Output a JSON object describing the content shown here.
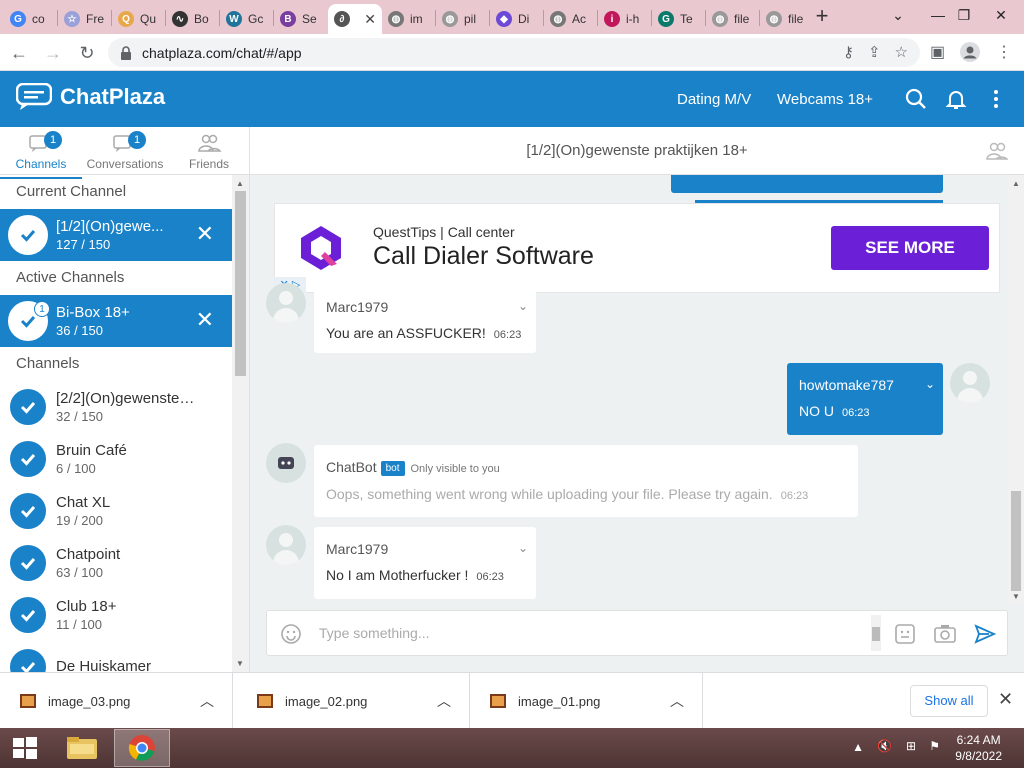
{
  "browser": {
    "tabs": [
      {
        "label": "co",
        "color": "#4285f4",
        "glyph": "G"
      },
      {
        "label": "Fre",
        "color": "#9aa0d8",
        "glyph": "☆"
      },
      {
        "label": "Qu",
        "color": "#e8a84a",
        "glyph": "Q"
      },
      {
        "label": "Bo",
        "color": "#333333",
        "glyph": "∿"
      },
      {
        "label": "Gc",
        "color": "#21759b",
        "glyph": "W"
      },
      {
        "label": "Se",
        "color": "#7a3ea1",
        "glyph": "B"
      },
      {
        "label": "",
        "color": "#555555",
        "glyph": "∂"
      },
      {
        "label": "im",
        "color": "#777777",
        "glyph": "◍"
      },
      {
        "label": "pil",
        "color": "#999999",
        "glyph": "◍"
      },
      {
        "label": "Di",
        "color": "#6d4ad6",
        "glyph": "◆"
      },
      {
        "label": "Ac",
        "color": "#777777",
        "glyph": "◍"
      },
      {
        "label": "i-h",
        "color": "#c2185b",
        "glyph": "i"
      },
      {
        "label": "Te",
        "color": "#0b7a6b",
        "glyph": "G"
      },
      {
        "label": "file",
        "color": "#999999",
        "glyph": "◍"
      },
      {
        "label": "file",
        "color": "#999999",
        "glyph": "◍"
      }
    ],
    "active_tab_index": 6,
    "url": "chatplaza.com/chat/#/app"
  },
  "app": {
    "logo_text": "ChatPlaza",
    "header_links": [
      "Dating M/V",
      "Webcams 18+"
    ],
    "brand_color": "#1a82c9"
  },
  "sidebar": {
    "tabs": [
      {
        "label": "Channels",
        "badge": "1",
        "icon": "chat-bubbles-icon"
      },
      {
        "label": "Conversations",
        "badge": "1",
        "icon": "conversation-icon"
      },
      {
        "label": "Friends",
        "badge": "",
        "icon": "friends-icon"
      }
    ],
    "sections": {
      "current": "Current Channel",
      "active": "Active Channels",
      "channels": "Channels"
    },
    "current_channel": {
      "name": "[1/2](On)gewe...",
      "count": "127 / 150"
    },
    "active_channels": [
      {
        "name": "Bi-Box 18+",
        "count": "36 / 150",
        "badge": "1"
      }
    ],
    "channels": [
      {
        "name": "[2/2](On)gewenste pr...",
        "count": "32 / 150"
      },
      {
        "name": "Bruin Café",
        "count": "6 / 100"
      },
      {
        "name": "Chat XL",
        "count": "19 / 200"
      },
      {
        "name": "Chatpoint",
        "count": "63 / 100"
      },
      {
        "name": "Club 18+",
        "count": "11 / 100"
      },
      {
        "name": "De Huiskamer",
        "count": ""
      }
    ]
  },
  "chat": {
    "title": "[1/2](On)gewenste praktijken 18+",
    "ad": {
      "small": "QuestTips | Call center",
      "big": "Call Dialer Software",
      "button": "SEE MORE",
      "button_color": "#6b1fd6"
    },
    "messages": [
      {
        "user": "Marc1979",
        "text": "You are an ASSFUCKER!",
        "time": "06:23"
      },
      {
        "user": "howtomake787",
        "text": "NO U",
        "time": "06:23"
      },
      {
        "user": "ChatBot",
        "badge": "bot",
        "note": "Only visible to you",
        "text": "Oops, something went wrong while uploading your file. Please try again.",
        "time": "06:23"
      },
      {
        "user": "Marc1979",
        "text": "No I am Motherfucker !",
        "time": "06:23"
      }
    ],
    "input_placeholder": "Type something..."
  },
  "downloads": {
    "files": [
      "image_03.png",
      "image_02.png",
      "image_01.png"
    ],
    "show_all": "Show all"
  },
  "taskbar": {
    "time": "6:24 AM",
    "date": "9/8/2022"
  }
}
